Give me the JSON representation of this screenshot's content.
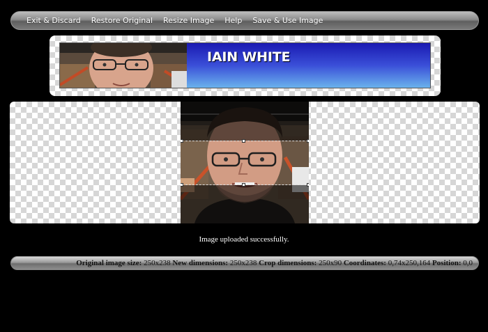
{
  "toolbar": {
    "items": [
      "Exit & Discard",
      "Restore Original",
      "Resize Image",
      "Help",
      "Save & Use Image"
    ]
  },
  "banner": {
    "title": "IAIN WHITE",
    "gradient_top": "#1b1ab2",
    "gradient_bottom": "#6ab2ec"
  },
  "status": {
    "message": "Image uploaded successfully."
  },
  "info": {
    "original_label": "Original image size:",
    "original_value": "250x238",
    "new_label": "New dimensions:",
    "new_value": "250x238",
    "crop_label": "Crop dimensions:",
    "crop_value": "250x90",
    "coords_label": "Coordinates:",
    "coords_value": "0,74x250,164",
    "position_label": "Position:",
    "position_value": "0,0"
  },
  "colors": {
    "background": "#000000",
    "toolbar_text": "#ffffff"
  }
}
